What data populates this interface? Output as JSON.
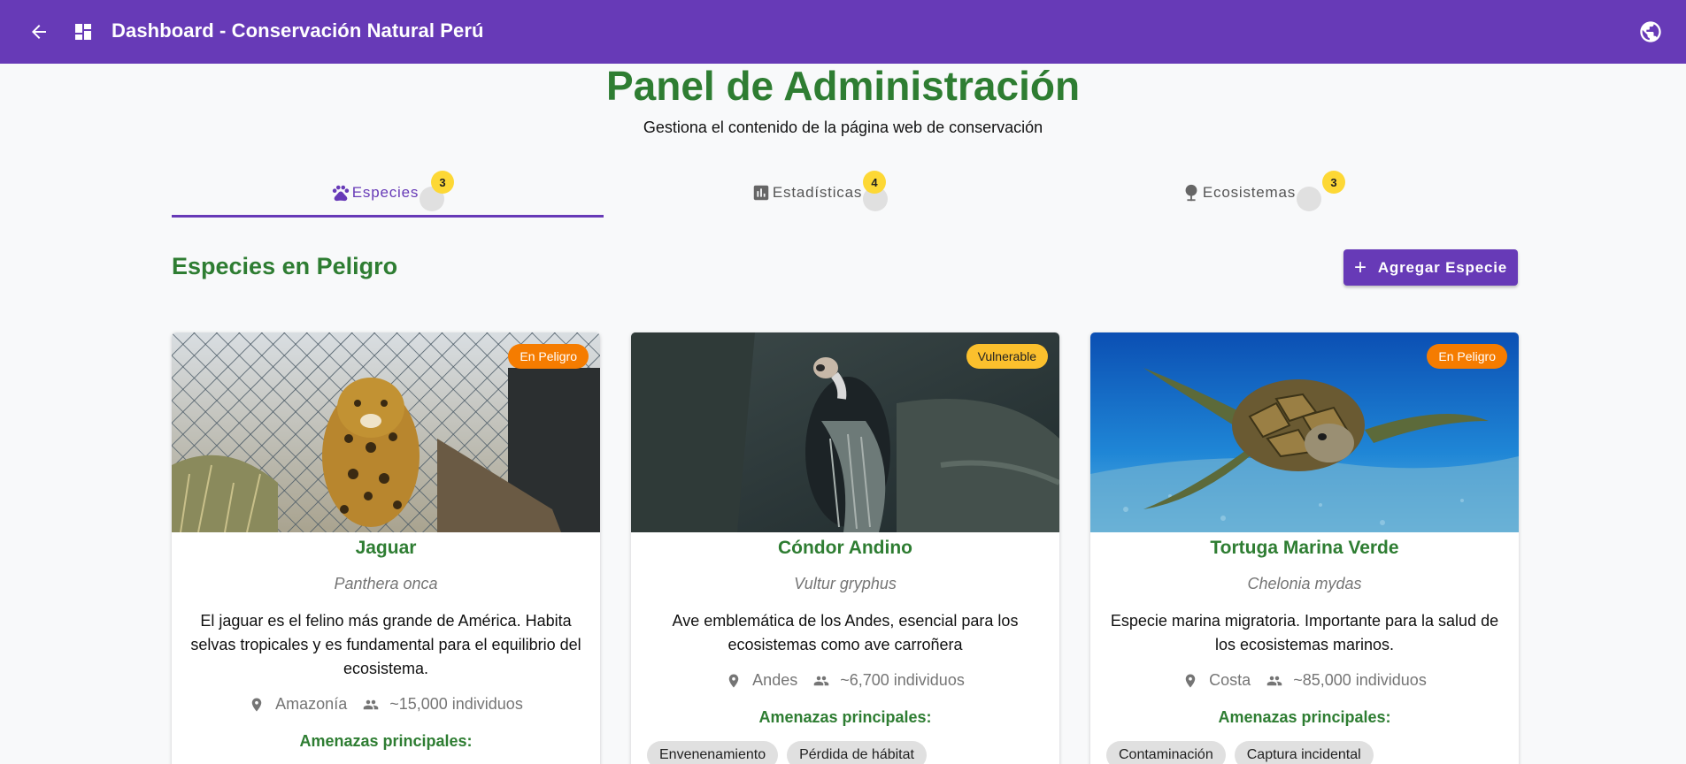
{
  "header": {
    "title": "Dashboard - Conservación Natural Perú",
    "back_icon": "arrow-back-icon",
    "dashboard_icon": "dashboard-icon",
    "language_icon": "globe-icon"
  },
  "page": {
    "title": "Panel de Administración",
    "subtitle": "Gestiona el contenido de la página web de conservación"
  },
  "tabs": [
    {
      "label": "Especies",
      "icon": "paw-icon",
      "badge": "3",
      "active": true
    },
    {
      "label": "Estadísticas",
      "icon": "bar-chart-icon",
      "badge": "4",
      "active": false
    },
    {
      "label": "Ecosistemas",
      "icon": "tree-icon",
      "badge": "3",
      "active": false
    }
  ],
  "section": {
    "title": "Especies en Peligro",
    "add_button": "Agregar Especie"
  },
  "species": [
    {
      "name": "Jaguar",
      "scientific": "Panthera onca",
      "status": "En Peligro",
      "description": "El jaguar es el felino más grande de América. Habita selvas tropicales y es fundamental para el equilibrio del ecosistema.",
      "region": "Amazonía",
      "population": "~15,000 individuos",
      "threats_label": "Amenazas principales:",
      "threats": []
    },
    {
      "name": "Cóndor Andino",
      "scientific": "Vultur gryphus",
      "status": "Vulnerable",
      "description": "Ave emblemática de los Andes, esencial para los ecosistemas como ave carroñera",
      "region": "Andes",
      "population": "~6,700 individuos",
      "threats_label": "Amenazas principales:",
      "threats": [
        "Envenenamiento",
        "Pérdida de hábitat"
      ]
    },
    {
      "name": "Tortuga Marina Verde",
      "scientific": "Chelonia mydas",
      "status": "En Peligro",
      "description": "Especie marina migratoria. Importante para la salud de los ecosistemas marinos.",
      "region": "Costa",
      "population": "~85,000 individuos",
      "threats_label": "Amenazas principales:",
      "threats": [
        "Contaminación",
        "Captura incidental"
      ]
    }
  ],
  "colors": {
    "primary": "#673ab7",
    "green": "#2e7d32",
    "badge": "#fdd835",
    "danger": "#f57c00",
    "vulnerable": "#fbc02d"
  }
}
